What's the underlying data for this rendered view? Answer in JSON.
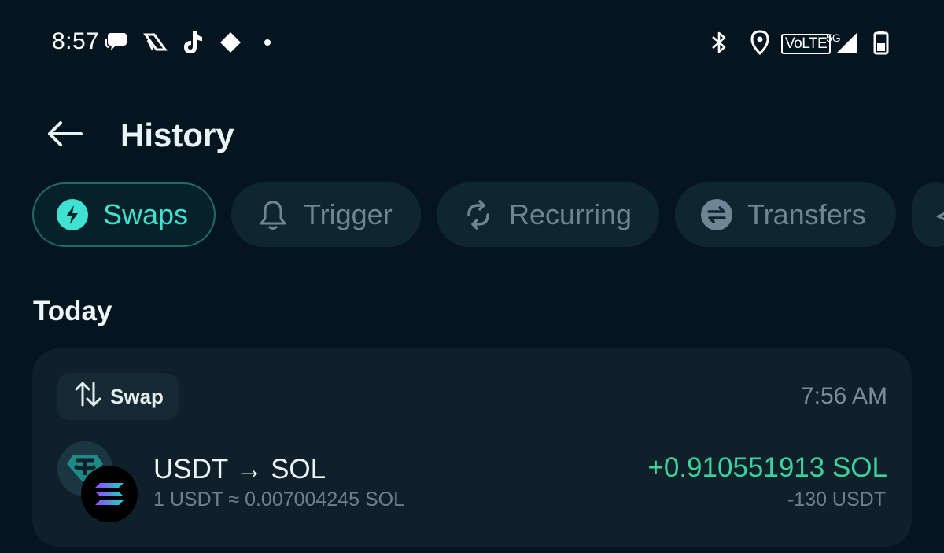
{
  "status_bar": {
    "time": "8:57",
    "left_icons": [
      "chat-bubble-icon",
      "app-logo-icon",
      "tiktok-icon",
      "diamond-icon",
      "dot-icon"
    ],
    "right_icons": [
      "bluetooth-icon",
      "location-pin-icon",
      "volte-badge",
      "signal-icon",
      "battery-icon"
    ],
    "volte": "VoLTE",
    "network": "5G"
  },
  "header": {
    "title": "History",
    "back_icon": "arrow-left-icon"
  },
  "tabs": [
    {
      "label": "Swaps",
      "icon": "lightning-icon",
      "active": true
    },
    {
      "label": "Trigger",
      "icon": "bell-icon",
      "active": false
    },
    {
      "label": "Recurring",
      "icon": "refresh-icon",
      "active": false
    },
    {
      "label": "Transfers",
      "icon": "transfer-arrows-icon",
      "active": false
    }
  ],
  "section": {
    "title": "Today"
  },
  "transaction": {
    "type_label": "Swap",
    "type_icon": "swap-vertical-icon",
    "time": "7:56 AM",
    "pair": "USDT → SOL",
    "rate": "1 USDT ≈ 0.007004245 SOL",
    "received": "+0.910551913 SOL",
    "sent": "-130 USDT",
    "from_token_icon": "usdt-token-icon",
    "to_token_icon": "sol-token-icon"
  },
  "colors": {
    "background": "#04151f",
    "accent": "#3fe1d1",
    "positive": "#3cd39b",
    "muted": "#6d808a"
  }
}
